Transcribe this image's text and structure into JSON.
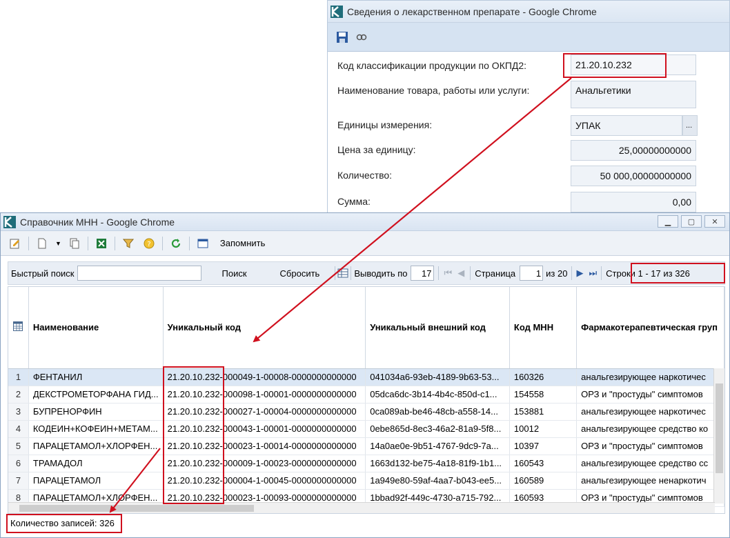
{
  "top_window": {
    "title": "Сведения о лекарственном препарате - Google Chrome",
    "form": {
      "okpd2_label": "Код классификации продукции по ОКПД2:",
      "okpd2_value": "21.20.10.232",
      "name_label": "Наименование товара, работы или услуги:",
      "name_value": "Анальгетики",
      "units_label": "Единицы измерения:",
      "units_value": "УПАК",
      "units_btn": "...",
      "price_label": "Цена за единицу:",
      "price_value": "25,00000000000",
      "qty_label": "Количество:",
      "qty_value": "50 000,00000000000",
      "sum_label": "Сумма:",
      "sum_value": "0,00"
    }
  },
  "bottom_window": {
    "title": "Справочник МНН - Google Chrome",
    "toolbar": {
      "remember_label": "Запомнить"
    },
    "search": {
      "quick_search_label": "Быстрый поиск",
      "quick_search_value": "",
      "search_btn": "Поиск",
      "reset_btn": "Сбросить",
      "per_page_label": "Выводить по",
      "per_page_value": "17",
      "page_label": "Страница",
      "page_value": "1",
      "of_pages": "из 20",
      "rows_info": "Строки 1 - 17 из 326"
    },
    "table": {
      "columns": [
        "Наименование",
        "Уникальный код",
        "Уникальный внешний код",
        "Код МНН",
        "Фармакотерапевтическая груп"
      ],
      "rows": [
        {
          "n": "1",
          "name": "ФЕНТАНИЛ",
          "code": "21.20.10.232-000049-1-00008-0000000000000",
          "ext": "041034a6-93eb-4189-9b63-53...",
          "mnn": "160326",
          "group": "анальгезирующее наркотичес"
        },
        {
          "n": "2",
          "name": "ДЕКСТРОМЕТОРФАНА ГИД...",
          "code": "21.20.10.232-000098-1-00001-0000000000000",
          "ext": "05dca6dc-3b14-4b4c-850d-c1...",
          "mnn": "154558",
          "group": "ОРЗ и \"простуды\" симптомов"
        },
        {
          "n": "3",
          "name": "БУПРЕНОРФИН",
          "code": "21.20.10.232-000027-1-00004-0000000000000",
          "ext": "0ca089ab-be46-48cb-a558-14...",
          "mnn": "153881",
          "group": "анальгезирующее наркотичес"
        },
        {
          "n": "4",
          "name": "КОДЕИН+КОФЕИН+МЕТАМ...",
          "code": "21.20.10.232-000043-1-00001-0000000000000",
          "ext": "0ebe865d-8ec3-46a2-81a9-5f8...",
          "mnn": "10012",
          "group": "анальгезирующее средство ко"
        },
        {
          "n": "5",
          "name": "ПАРАЦЕТАМОЛ+ХЛОРФЕН...",
          "code": "21.20.10.232-000023-1-00014-0000000000000",
          "ext": "14a0ae0e-9b51-4767-9dc9-7a...",
          "mnn": "10397",
          "group": "ОРЗ и \"простуды\" симптомов"
        },
        {
          "n": "6",
          "name": "ТРАМАДОЛ",
          "code": "21.20.10.232-000009-1-00023-0000000000000",
          "ext": "1663d132-be75-4a18-81f9-1b1...",
          "mnn": "160543",
          "group": "анальгезирующее средство сс"
        },
        {
          "n": "7",
          "name": "ПАРАЦЕТАМОЛ",
          "code": "21.20.10.232-000004-1-00045-0000000000000",
          "ext": "1a949e80-59af-4aa7-b043-ee5...",
          "mnn": "160589",
          "group": "анальгезирующее ненаркотич"
        },
        {
          "n": "8",
          "name": "ПАРАЦЕТАМОЛ+ХЛОРФЕН...",
          "code": "21.20.10.232-000023-1-00093-0000000000000",
          "ext": "1bbad92f-449c-4730-a715-792...",
          "mnn": "160593",
          "group": "ОРЗ и \"простуды\" симптомов"
        }
      ]
    },
    "status": {
      "records": "Количество записей: 326"
    }
  },
  "colors": {
    "highlight": "#d0101e",
    "selected_row": "#dbe7f5",
    "toolbar_bg": "#d6e3f2"
  },
  "icons": [
    "app-logo-icon",
    "save-icon",
    "link-icon",
    "edit-icon",
    "new-doc-icon",
    "copy-icon",
    "excel-icon",
    "filter-icon",
    "help-icon",
    "refresh-icon",
    "table-view-icon",
    "grid-icon",
    "first-page-icon",
    "prev-page-icon",
    "next-page-icon",
    "last-page-icon",
    "minimize-icon",
    "maximize-icon",
    "close-icon"
  ]
}
